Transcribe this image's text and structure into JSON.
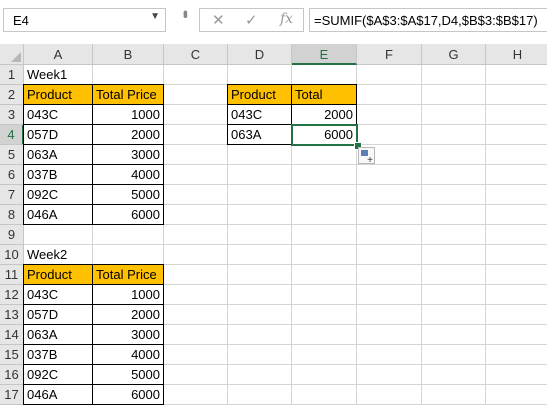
{
  "formula_bar": {
    "name_box": "E4",
    "formula": "=SUMIF($A$3:$A$17,D4,$B$3:$B$17)"
  },
  "columns": [
    "A",
    "B",
    "C",
    "D",
    "E",
    "F",
    "G",
    "H"
  ],
  "rows": [
    "1",
    "2",
    "3",
    "4",
    "5",
    "6",
    "7",
    "8",
    "9",
    "10",
    "11",
    "12",
    "13",
    "14",
    "15",
    "16",
    "17"
  ],
  "week1": {
    "title": "Week1",
    "headers": [
      "Product",
      "Total Price"
    ],
    "rows": [
      [
        "043C",
        "1000"
      ],
      [
        "057D",
        "2000"
      ],
      [
        "063A",
        "3000"
      ],
      [
        "037B",
        "4000"
      ],
      [
        "092C",
        "5000"
      ],
      [
        "046A",
        "6000"
      ]
    ]
  },
  "week2": {
    "title": "Week2",
    "headers": [
      "Product",
      "Total Price"
    ],
    "rows": [
      [
        "043C",
        "1000"
      ],
      [
        "057D",
        "2000"
      ],
      [
        "063A",
        "3000"
      ],
      [
        "037B",
        "4000"
      ],
      [
        "092C",
        "5000"
      ],
      [
        "046A",
        "6000"
      ]
    ]
  },
  "summary": {
    "headers": [
      "Product",
      "Total"
    ],
    "rows": [
      [
        "043C",
        "2000"
      ],
      [
        "063A",
        "6000"
      ]
    ]
  },
  "colors": {
    "header_fill": "#ffc000",
    "selection": "#217346"
  }
}
